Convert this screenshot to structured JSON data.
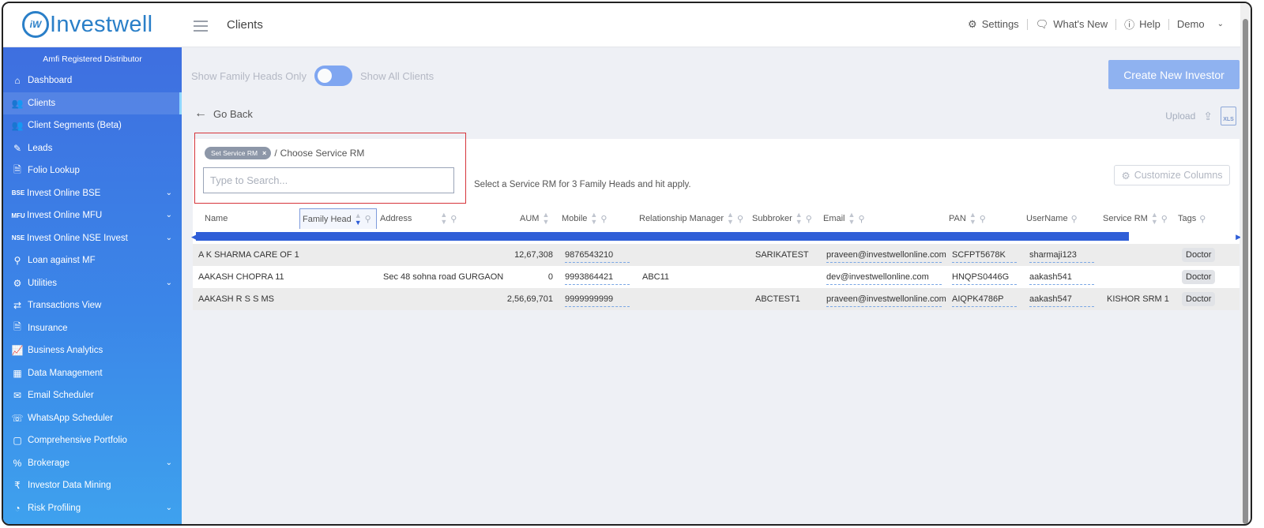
{
  "header": {
    "logo_mark": "iW",
    "logo_text": "Investwell",
    "page_title": "Clients",
    "settings_label": "Settings",
    "whats_new_label": "What's New",
    "help_label": "Help",
    "user_label": "Demo"
  },
  "sidebar": {
    "distributor_label": "Amfi Registered Distributor",
    "items": [
      {
        "label": "Dashboard",
        "icon": "home-icon",
        "glyph": "⌂"
      },
      {
        "label": "Clients",
        "icon": "users-icon",
        "glyph": "👥"
      },
      {
        "label": "Client Segments (Beta)",
        "icon": "segments-icon",
        "glyph": "👥"
      },
      {
        "label": "Leads",
        "icon": "leads-icon",
        "glyph": "✎"
      },
      {
        "label": "Folio Lookup",
        "icon": "folio-icon",
        "glyph": "🗎"
      },
      {
        "label": "Invest Online BSE",
        "icon": "bse-icon",
        "glyph": "BSE"
      },
      {
        "label": "Invest Online MFU",
        "icon": "mfu-icon",
        "glyph": "MFU"
      },
      {
        "label": "Invest Online NSE Invest",
        "icon": "nse-icon",
        "glyph": "NSE"
      },
      {
        "label": "Loan against MF",
        "icon": "loan-icon",
        "glyph": "⚲"
      },
      {
        "label": "Utilities",
        "icon": "utilities-icon",
        "glyph": "⚙"
      },
      {
        "label": "Transactions View",
        "icon": "transactions-icon",
        "glyph": "⇄"
      },
      {
        "label": "Insurance",
        "icon": "insurance-icon",
        "glyph": "🗎"
      },
      {
        "label": "Business Analytics",
        "icon": "analytics-icon",
        "glyph": "📈"
      },
      {
        "label": "Data Management",
        "icon": "data-icon",
        "glyph": "▦"
      },
      {
        "label": "Email Scheduler",
        "icon": "email-icon",
        "glyph": "✉"
      },
      {
        "label": "WhatsApp Scheduler",
        "icon": "whatsapp-icon",
        "glyph": "☏"
      },
      {
        "label": "Comprehensive Portfolio",
        "icon": "portfolio-icon",
        "glyph": "▢"
      },
      {
        "label": "Brokerage",
        "icon": "brokerage-icon",
        "glyph": "%"
      },
      {
        "label": "Investor Data Mining",
        "icon": "mining-icon",
        "glyph": "₹"
      },
      {
        "label": "Risk Profiling",
        "icon": "risk-icon",
        "glyph": "◔"
      }
    ]
  },
  "controls": {
    "family_heads_label": "Show Family Heads Only",
    "all_clients_label": "Show All Clients",
    "create_button": "Create New Investor",
    "go_back": "Go Back",
    "upload_label": "Upload",
    "xls_label": "XLS"
  },
  "service_rm": {
    "chip_label": "Set Service RM",
    "chip_close": "×",
    "separator": "/",
    "choose_label": "Choose Service RM",
    "search_placeholder": "Type to Search...",
    "hint": "Select a Service RM for 3 Family Heads and hit apply.",
    "customize_button": "Customize Columns"
  },
  "table": {
    "columns": {
      "name": "Name",
      "family_head": "Family Head",
      "address": "Address",
      "aum": "AUM",
      "mobile": "Mobile",
      "relationship_manager": "Relationship Manager",
      "subbroker": "Subbroker",
      "email": "Email",
      "pan": "PAN",
      "username": "UserName",
      "service_rm": "Service RM",
      "tags": "Tags"
    },
    "rows": [
      {
        "name": "A K SHARMA CARE OF 1",
        "address": "",
        "aum": "12,67,308",
        "mobile": "9876543210",
        "rm": "",
        "subbroker": "SARIKATEST",
        "email": "praveen@investwellonline.com",
        "pan": "SCFPT5678K",
        "username": "sharmaji123",
        "service_rm": "",
        "tag": "Doctor"
      },
      {
        "name": "AAKASH CHOPRA 11",
        "address": "Sec 48 sohna road GURGAON",
        "aum": "0",
        "mobile": "9993864421",
        "rm": "ABC11",
        "subbroker": "",
        "email": "dev@investwellonline.com",
        "pan": "HNQPS0446G",
        "username": "aakash541",
        "service_rm": "",
        "tag": "Doctor"
      },
      {
        "name": "AAKASH R S S MS",
        "address": "",
        "aum": "2,56,69,701",
        "mobile": "9999999999",
        "rm": "",
        "subbroker": "ABCTEST1",
        "email": "praveen@investwellonline.com",
        "pan": "AIQPK4786P",
        "username": "aakash547",
        "service_rm": "KISHOR SRM 1",
        "tag": "Doctor"
      }
    ]
  },
  "colors": {
    "brand": "#2a7fc8",
    "sidebar_top": "#3e6fe0",
    "sidebar_bottom": "#3ea2ee",
    "primary_button": "#8fb2f0",
    "highlight_border": "#d6353b",
    "scroll_thumb": "#2f5ed7"
  }
}
